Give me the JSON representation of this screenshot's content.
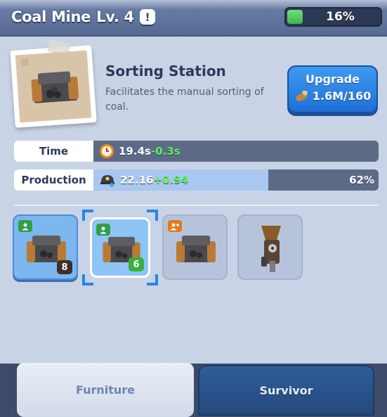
{
  "header": {
    "building_name": "Coal Mine",
    "level": "Lv. 4",
    "info_glyph": "!",
    "progress_text": "16%",
    "progress_value": 0.16
  },
  "item": {
    "name": "Sorting Station",
    "description": "Facilitates the manual sorting of coal."
  },
  "upgrade": {
    "label": "Upgrade",
    "cost": "1.6M/160",
    "cost_icon": "wood-log-icon"
  },
  "stats": {
    "time": {
      "label": "Time",
      "value": "19.4s",
      "bonus": "-0.3s",
      "icon": "clock-icon"
    },
    "production": {
      "label": "Production",
      "value": "22.16",
      "bonus": "+0.94",
      "percent": "62%",
      "fill": 0.62,
      "icon": "coal-helmet-icon"
    }
  },
  "slots": [
    {
      "badge": "person",
      "count": "8",
      "count_color": "dark",
      "state": "owned"
    },
    {
      "badge": "person",
      "count": "6",
      "count_color": "green",
      "state": "selected"
    },
    {
      "badge": "person-add",
      "state": "locked"
    },
    {
      "badge": "",
      "state": "locked"
    }
  ],
  "tabs": {
    "furniture": "Furniture",
    "survivor": "Survivor"
  },
  "colors": {
    "accent_blue": "#1f6fd6",
    "progress_green": "#3cb54a",
    "bonus_green": "#5ff05c"
  }
}
